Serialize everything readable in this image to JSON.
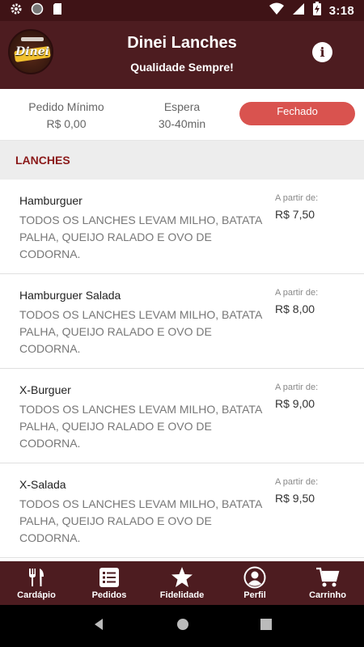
{
  "status_bar": {
    "time": "3:18"
  },
  "header": {
    "logo_text": "Dinei",
    "title": "Dinei Lanches",
    "subtitle": "Qualidade Sempre!",
    "info_label": "i"
  },
  "store_info": {
    "min_order_label": "Pedido Mínimo",
    "min_order_value": "R$ 0,00",
    "wait_label": "Espera",
    "wait_value": "30-40min",
    "status_badge": "Fechado"
  },
  "section": {
    "title": "LANCHES"
  },
  "products": [
    {
      "name": "Hamburguer",
      "description": "TODOS OS LANCHES LEVAM MILHO, BATATA PALHA, QUEIJO RALADO E OVO DE CODORNA.",
      "from_label": "A partir de:",
      "price": "R$ 7,50"
    },
    {
      "name": "Hamburguer Salada",
      "description": "TODOS OS LANCHES LEVAM MILHO, BATATA PALHA, QUEIJO RALADO E OVO DE CODORNA.",
      "from_label": "A partir de:",
      "price": "R$ 8,00"
    },
    {
      "name": "X-Burguer",
      "description": "TODOS OS LANCHES LEVAM MILHO, BATATA PALHA, QUEIJO RALADO E OVO DE CODORNA.",
      "from_label": "A partir de:",
      "price": "R$ 9,00"
    },
    {
      "name": "X-Salada",
      "description": "TODOS OS LANCHES LEVAM MILHO, BATATA PALHA, QUEIJO RALADO E OVO DE CODORNA.",
      "from_label": "A partir de:",
      "price": "R$ 9,50"
    }
  ],
  "bottom_nav": [
    {
      "label": "Cardápio",
      "icon": "fork-knife-icon"
    },
    {
      "label": "Pedidos",
      "icon": "list-icon"
    },
    {
      "label": "Fidelidade",
      "icon": "star-icon"
    },
    {
      "label": "Perfil",
      "icon": "user-icon"
    },
    {
      "label": "Carrinho",
      "icon": "cart-icon"
    }
  ],
  "colors": {
    "header_bg": "#4d1c20",
    "status_bar_bg": "#3f1316",
    "closed_badge": "#d9534f",
    "section_title": "#8b1a1a"
  }
}
